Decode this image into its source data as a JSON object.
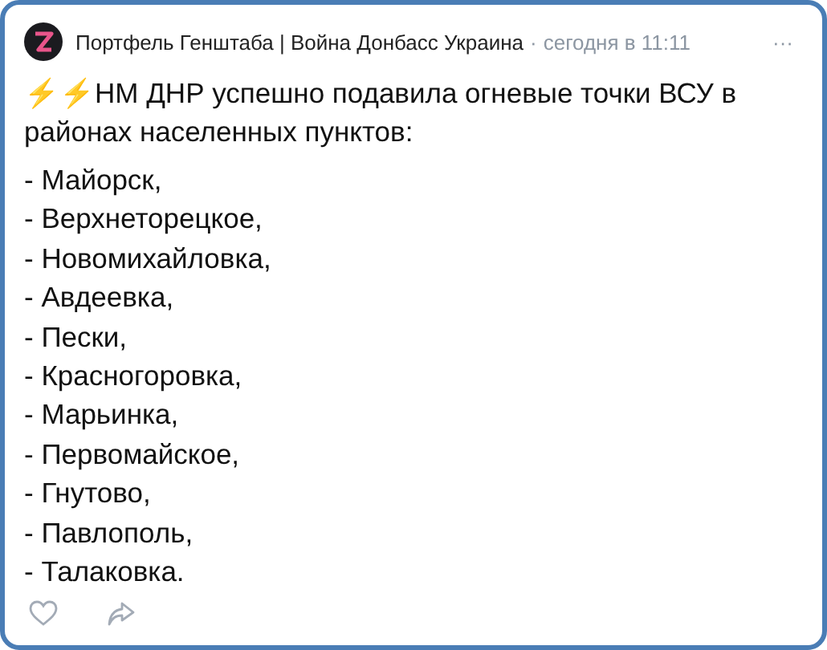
{
  "post": {
    "author": "Портфель Генштаба | Война Донбасс Украина",
    "separator": "·",
    "time": "сегодня в 11:11",
    "menu": "···",
    "emoji": "⚡⚡",
    "headline": "НМ ДНР успешно подавила огневые точки ВСУ в районах населенных пунктов:",
    "places": [
      "- Майорск,",
      "- Верхнеторецкое,",
      "- Новомихайловка,",
      "- Авдеевка,",
      "- Пески,",
      "- Красногоровка,",
      "- Марьинка,",
      "- Первомайское,",
      "- Гнутово,",
      "- Павлополь,",
      "- Талаковка."
    ],
    "liked": false
  }
}
